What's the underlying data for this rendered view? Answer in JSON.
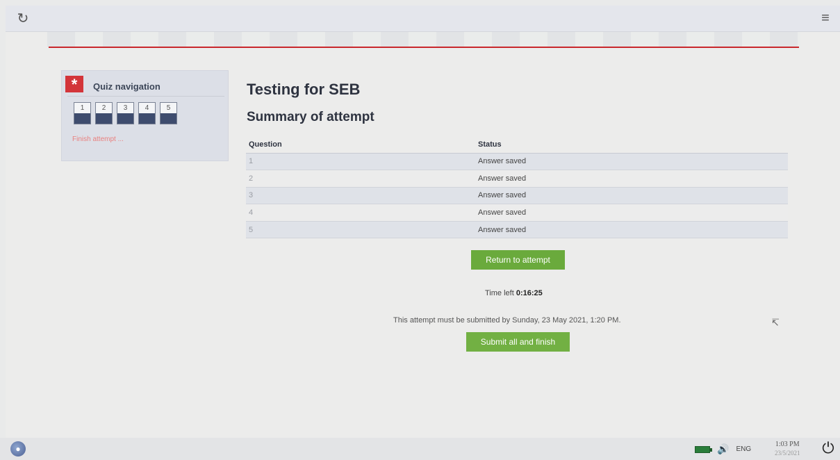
{
  "topbar": {
    "reload_icon": "reload-icon",
    "menu_icon": "hamburger-menu-icon"
  },
  "quiz_nav": {
    "title": "Quiz navigation",
    "buttons": [
      "1",
      "2",
      "3",
      "4",
      "5"
    ],
    "finish_link": "Finish attempt ..."
  },
  "main": {
    "title": "Testing for SEB",
    "subtitle": "Summary of attempt"
  },
  "table": {
    "headers": [
      "Question",
      "Status"
    ],
    "rows": [
      {
        "question": "1",
        "status": "Answer saved"
      },
      {
        "question": "2",
        "status": "Answer saved"
      },
      {
        "question": "3",
        "status": "Answer saved"
      },
      {
        "question": "4",
        "status": "Answer saved"
      },
      {
        "question": "5",
        "status": "Answer saved"
      }
    ]
  },
  "actions": {
    "return_label": "Return to attempt",
    "time_left_label": "Time left",
    "time_left_value": "0:16:25",
    "submit_note": "This attempt must be submitted by Sunday, 23 May 2021, 1:20 PM.",
    "submit_label": "Submit all and finish"
  },
  "taskbar": {
    "language": "ENG",
    "time": "1:03 PM",
    "date": "23/5/2021"
  },
  "colors": {
    "accent_red": "#c9272c",
    "button_green": "#6aaa3c",
    "nav_fill": "#3e4c6e"
  }
}
